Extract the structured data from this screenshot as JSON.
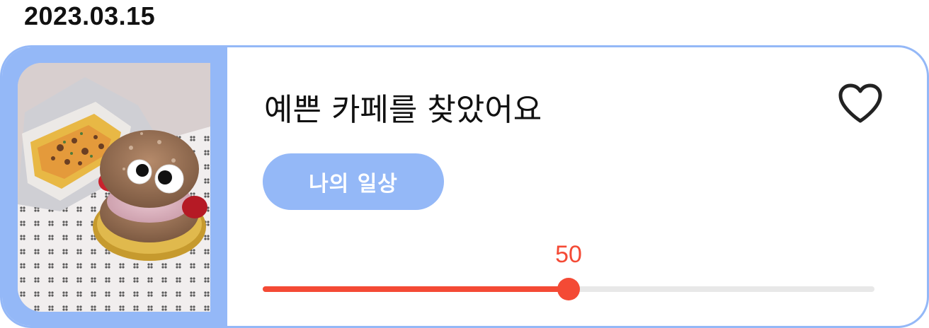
{
  "post": {
    "date": "2023.03.15",
    "title": "예쁜 카페를 찾았어요",
    "category_chip": "나의 일상",
    "liked": false,
    "photo_alt": "케이크 사진"
  },
  "slider": {
    "value": 50,
    "value_label": "50",
    "min": 0,
    "max": 100
  },
  "icons": {
    "favorite": "heart-outline-icon"
  },
  "colors": {
    "accent_blue": "#94b8f7",
    "slider_red": "#f44a35",
    "track_gray": "#e8e8e8",
    "text_dark": "#111111"
  }
}
